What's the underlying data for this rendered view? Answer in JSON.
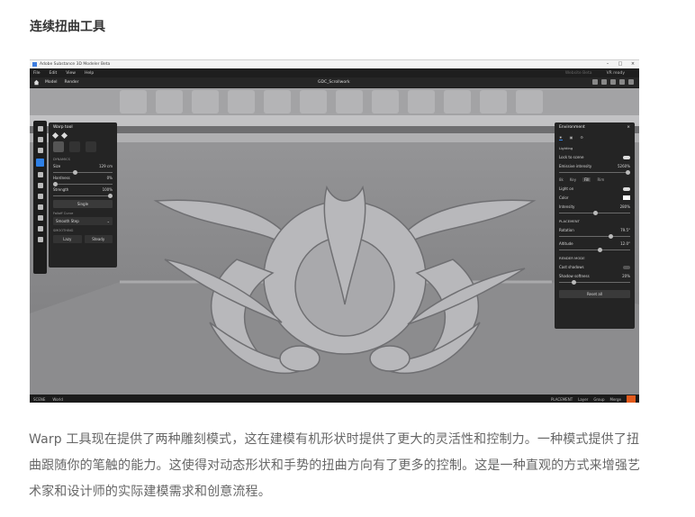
{
  "article": {
    "heading": "连续扭曲工具",
    "paragraph": "Warp 工具现在提供了两种雕刻模式，这在建模有机形状时提供了更大的灵活性和控制力。一种模式提供了扭曲跟随你的笔触的能力。这使得对动态形状和手势的扭曲方向有了更多的控制。这是一种直观的方式来增强艺术家和设计师的实际建模需求和创意流程。"
  },
  "app": {
    "window_title": "Adobe Substance 3D Modeler Beta",
    "window_controls": [
      "–",
      "□",
      "×"
    ],
    "menu": [
      "File",
      "Edit",
      "View",
      "Help"
    ],
    "menu_right": [
      "Website Beta",
      "VR ready"
    ],
    "tabs": [
      "Model",
      "Render"
    ],
    "document": "GDC_Scrollwork",
    "warp_panel": {
      "title": "Warp tool",
      "section_dynamics": "DYNAMICS",
      "size_label": "Size",
      "size_value": "129 cm",
      "hardness_label": "Hardness",
      "hardness_value": "0%",
      "strength_label": "Strength",
      "strength_value": "100%",
      "single_button": "Single",
      "falloff_label": "Falloff Curve",
      "falloff_value": "Smooth Step",
      "section_smoothing": "SMOOTHING",
      "lazy_button": "Lazy",
      "steady_button": "Steady"
    },
    "env_panel": {
      "title": "Environment",
      "section_lighting": "Lighting",
      "lock_label": "Lock to scene",
      "emissive_label": "Emissive intensity",
      "emissive_value": "5260%",
      "formats": [
        "8k",
        "Key",
        "Fill",
        "Rim"
      ],
      "active_format": "Fill",
      "light_on_label": "Light on",
      "color_label": "Color",
      "intensity_label": "Intensity",
      "intensity_value": "280%",
      "section_placement": "PLACEMENT",
      "rotation_label": "Rotation",
      "rotation_value": "79.5°",
      "altitude_label": "Altitude",
      "altitude_value": "12.0°",
      "section_render": "RENDER MODE",
      "shadows_label": "Cast shadows",
      "softness_label": "Shadow softness",
      "softness_value": "20%",
      "reset_button": "Reset all"
    },
    "status_left": [
      "SCENE",
      "World"
    ],
    "status_right": [
      "PLACEMENT",
      "Layer",
      "Group",
      "Merge"
    ]
  }
}
